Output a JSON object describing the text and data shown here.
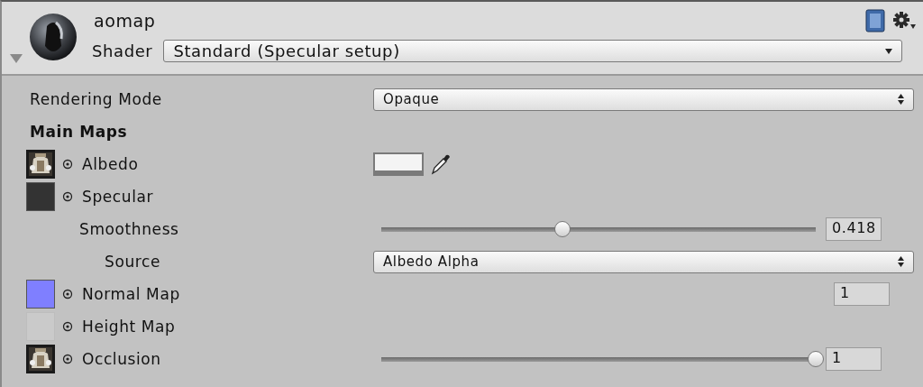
{
  "header": {
    "title": "aomap",
    "shader_label": "Shader",
    "shader": "Standard (Specular setup)"
  },
  "properties": [
    {
      "kind": "dropdown",
      "label": "Rendering Mode",
      "value": "Opaque"
    },
    {
      "kind": "heading",
      "label": "Main Maps"
    },
    {
      "kind": "texture",
      "label": "Albedo",
      "control": {
        "kind": "color",
        "color": "#f4f4f4"
      }
    },
    {
      "kind": "texture",
      "thumb": {
        "kind": "solid",
        "color": "#333333"
      },
      "label": "Specular",
      "children": [
        {
          "kind": "slider",
          "label": "Smoothness",
          "level": 0.418,
          "value": "0.418",
          "children": [
            {
              "kind": "dropdown",
              "label": "Source",
              "value": "Albedo Alpha"
            }
          ]
        }
      ]
    },
    {
      "kind": "texture",
      "thumb": {
        "kind": "solid",
        "color": "#7f7fff"
      },
      "label": "Normal Map",
      "control": {
        "kind": "number",
        "value": "1"
      }
    },
    {
      "kind": "texture",
      "thumb": {
        "kind": "empty"
      },
      "label": "Height Map"
    },
    {
      "kind": "texture",
      "label": "Occlusion",
      "control": {
        "kind": "slider",
        "level": 1,
        "value": "1"
      }
    }
  ]
}
